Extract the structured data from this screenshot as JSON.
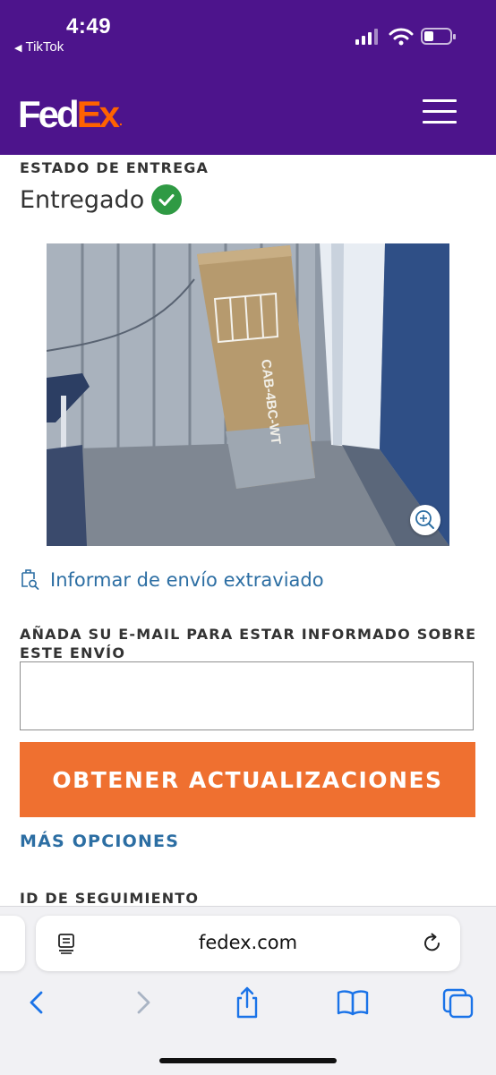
{
  "status_bar": {
    "time": "4:49",
    "back_app": "TikTok"
  },
  "header": {
    "logo_fed": "Fed",
    "logo_ex": "Ex",
    "logo_dot": ".",
    "brand_purple": "#4d148c",
    "brand_orange": "#ff6200",
    "menu_icon": "hamburger-icon"
  },
  "delivery": {
    "section_label": "ESTADO DE ENTREGA",
    "status": "Entregado",
    "status_icon": "check-circle-icon",
    "status_color": "#2f9a44"
  },
  "photo": {
    "box_label": "CAB-4BC-WT",
    "zoom_icon": "zoom-in-icon"
  },
  "lost_link": {
    "label": "Informar de envío extraviado",
    "icon": "package-search-icon"
  },
  "email_signup": {
    "label_line1": "AÑADA SU E-MAIL PARA ESTAR INFORMADO SOBRE",
    "label_line2": "ESTE ENVÍO",
    "value": "",
    "button_label": "OBTENER ACTUALIZACIONES",
    "button_color": "#ef7030"
  },
  "more_options": "MÁS OPCIONES",
  "tracking_id_label": "ID DE SEGUIMIENTO",
  "browser": {
    "url": "fedex.com",
    "toolbar": [
      "back-icon",
      "forward-icon",
      "share-icon",
      "bookmarks-icon",
      "tabs-icon"
    ]
  }
}
